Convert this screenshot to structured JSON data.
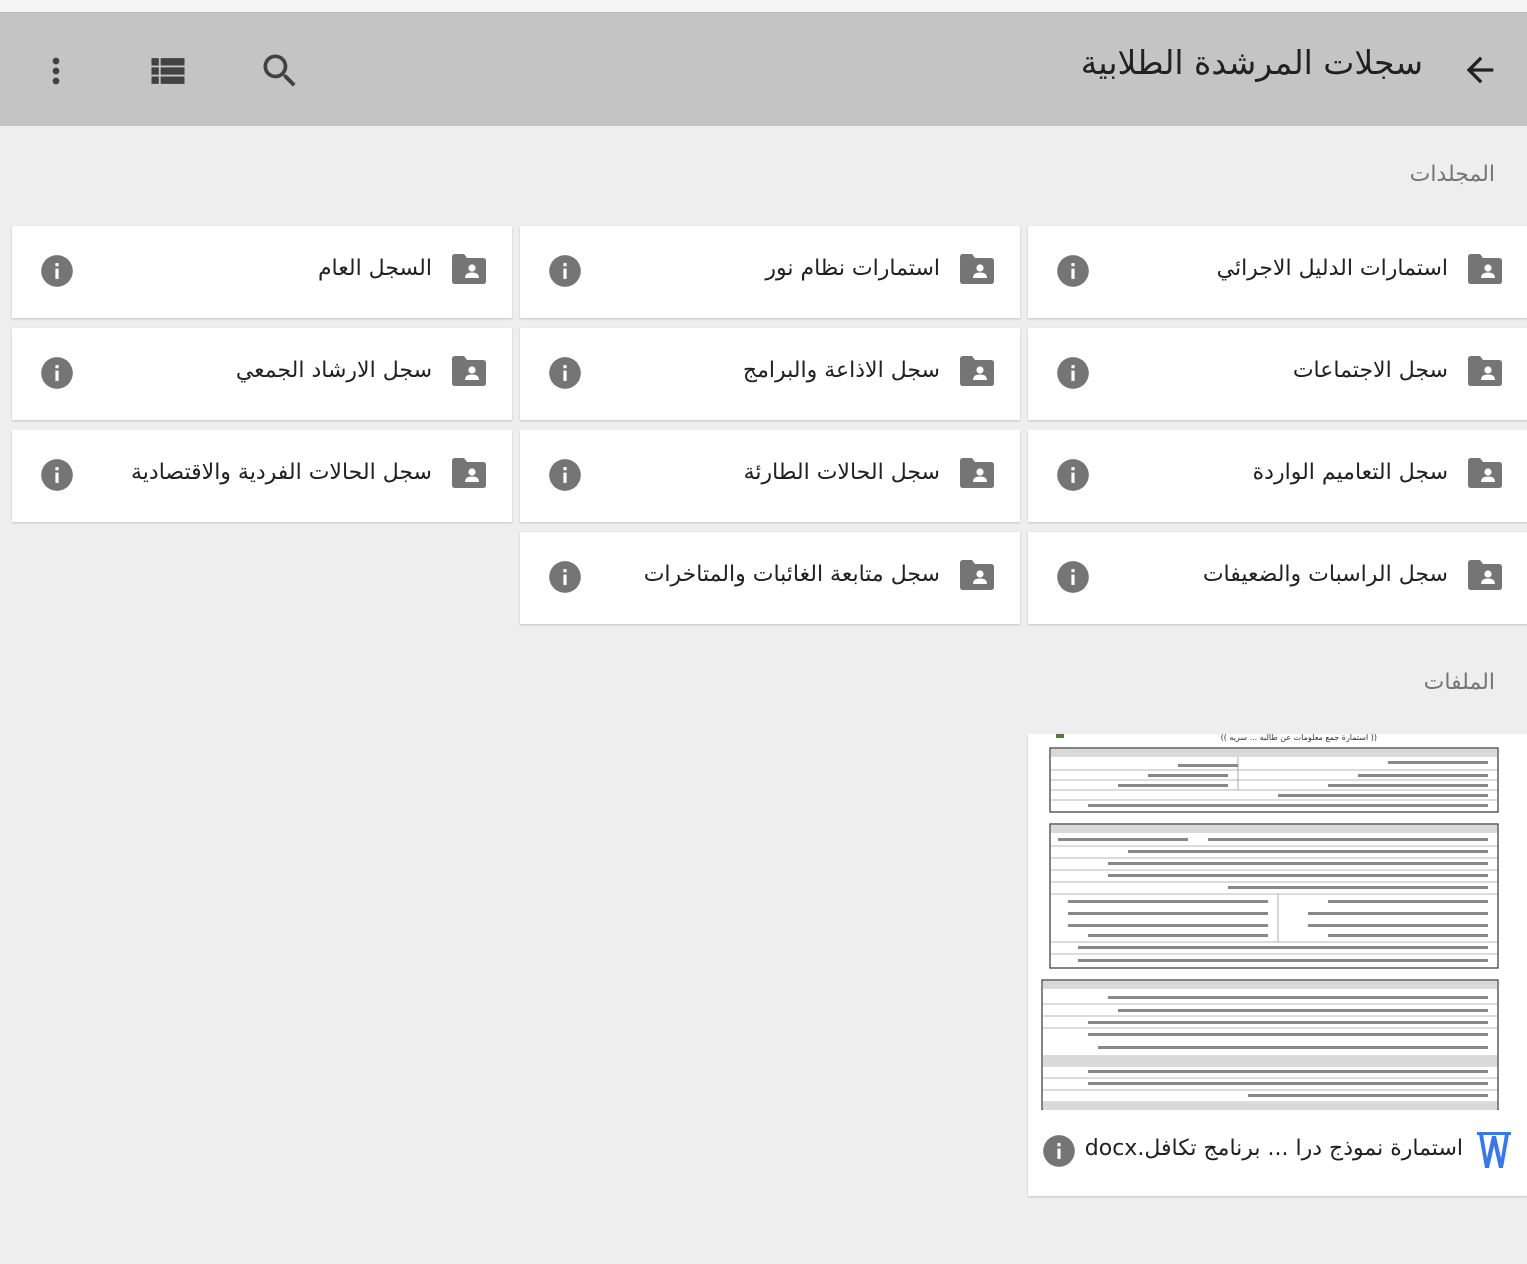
{
  "appbar": {
    "title": "سجلات المرشدة الطلابية",
    "icons": [
      "back-arrow-icon",
      "search-icon",
      "list-view-icon",
      "more-vert-icon"
    ]
  },
  "sections": {
    "folders_label": "المجلدات",
    "files_label": "الملفات"
  },
  "folders": [
    {
      "label": "استمارات الدليل الاجرائي"
    },
    {
      "label": "استمارات نظام نور"
    },
    {
      "label": "السجل العام"
    },
    {
      "label": "سجل الاجتماعات"
    },
    {
      "label": "سجل الاذاعة والبرامج"
    },
    {
      "label": "سجل الارشاد الجمعي"
    },
    {
      "label": "سجل التعاميم الواردة"
    },
    {
      "label": "سجل الحالات الطارئة"
    },
    {
      "label": "سجل الحالات الفردية والاقتصادية"
    },
    {
      "label": "سجل الراسبات والضعيفات"
    },
    {
      "label": "سجل متابعة الغائبات والمتاخرات"
    }
  ],
  "files": [
    {
      "name": "استمارة نموذج درا ... برنامج تكافل.docx",
      "type_icon": "word-doc-icon",
      "thumbnail_title": "(( استمارة جمع معلومات عن طالبه ... سريه ))"
    }
  ],
  "colors": {
    "appbar_bg": "#c4c4c4",
    "page_bg": "#eeeeee",
    "icon_grey": "#757575",
    "word_blue": "#3b78e7"
  }
}
